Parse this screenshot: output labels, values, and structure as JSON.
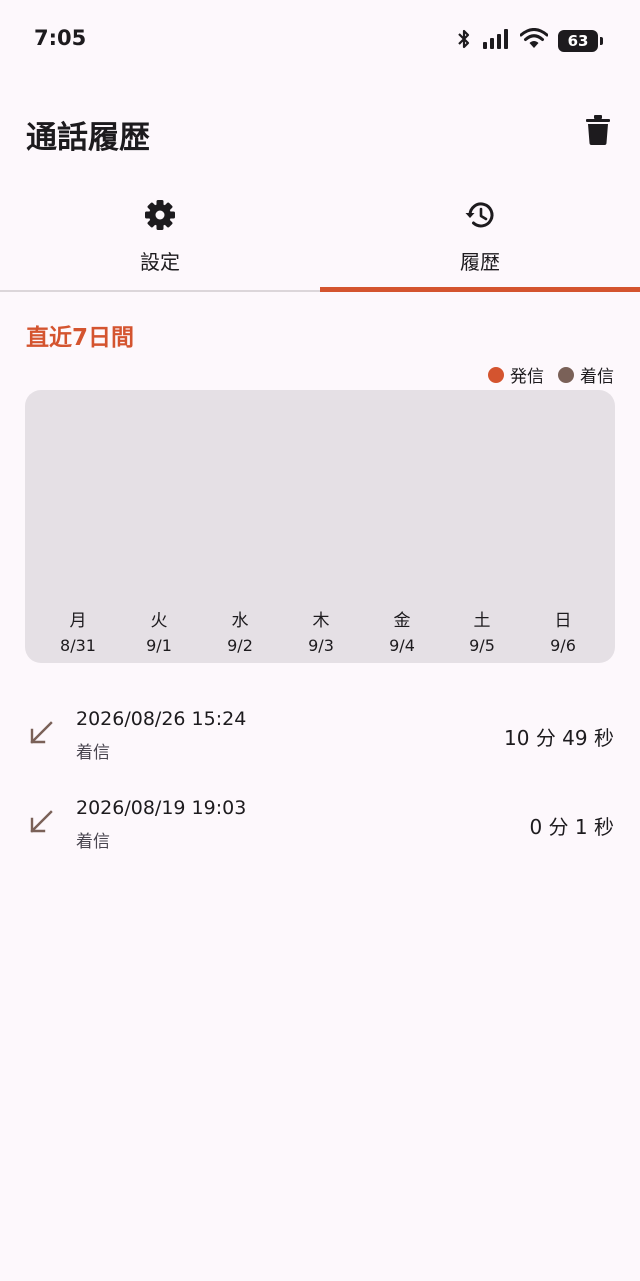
{
  "status_bar": {
    "time": "7:05",
    "battery_level": "63",
    "icons": [
      "bluetooth-icon",
      "cellular-signal-icon",
      "wifi-icon",
      "battery-icon"
    ]
  },
  "app_bar": {
    "title": "通話履歴",
    "action_icon": "trash-icon"
  },
  "tabs": [
    {
      "label": "設定",
      "icon": "gear-icon",
      "selected": false
    },
    {
      "label": "履歴",
      "icon": "history-icon",
      "selected": true
    }
  ],
  "section": {
    "title": "直近7日間"
  },
  "legend": [
    {
      "label": "発信",
      "color": "#d4542f"
    },
    {
      "label": "着信",
      "color": "#7a6158"
    }
  ],
  "chart_data": {
    "type": "bar",
    "title": "",
    "categories": [
      "月",
      "火",
      "水",
      "木",
      "金",
      "土",
      "日"
    ],
    "dates": [
      "8/31",
      "9/1",
      "9/2",
      "9/3",
      "9/4",
      "9/5",
      "9/6"
    ],
    "series": [
      {
        "name": "発信",
        "values": [
          0,
          0,
          0,
          0,
          0,
          0,
          0
        ]
      },
      {
        "name": "着信",
        "values": [
          0,
          0,
          0,
          0,
          0,
          0,
          0
        ]
      }
    ],
    "grid": false
  },
  "history": [
    {
      "datetime": "2026/08/26 15:24",
      "type": "着信",
      "duration": "10 分 49 秒",
      "icon": "incoming-call-arrow-icon"
    },
    {
      "datetime": "2026/08/19 19:03",
      "type": "着信",
      "duration": "0 分 1 秒",
      "icon": "incoming-call-arrow-icon"
    }
  ],
  "colors": {
    "accent": "#d4542f",
    "incoming": "#7a6158",
    "background": "#fdf8fc",
    "card": "#e5e0e5"
  }
}
